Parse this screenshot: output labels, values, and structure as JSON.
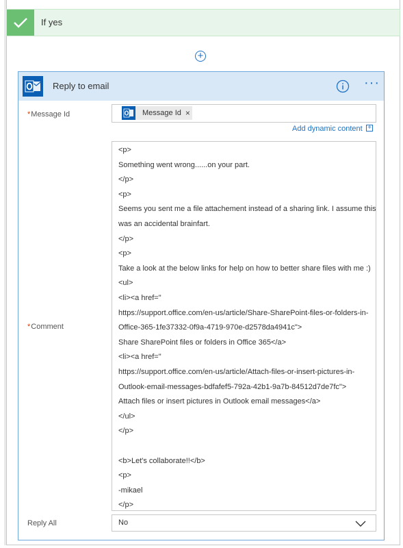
{
  "condition": {
    "label": "If yes"
  },
  "card": {
    "title": "Reply to email"
  },
  "fields": {
    "message_id": {
      "label": "Message Id",
      "required_marker": "*",
      "token_label": "Message Id",
      "token_remove": "×"
    },
    "add_dynamic_content": "Add dynamic content",
    "add_dynamic_plus": "+",
    "comment": {
      "label": "Comment",
      "required_marker": "*",
      "lines": [
        "<p>",
        "Something went wrong......on your part.",
        "</p>",
        "<p>",
        "Seems you sent me a file attachement instead of a sharing link. I assume this",
        "was an accidental brainfart.",
        "</p>",
        "<p>",
        "Take a look at the below links for help on how to better share files with me :)",
        "<ul>",
        "<li><a href=\"",
        "https://support.office.com/en-us/article/Share-SharePoint-files-or-folders-in-",
        "Office-365-1fe37332-0f9a-4719-970e-d2578da4941c\">",
        "Share SharePoint files or folders in Office 365</a>",
        "<li><a href=\"",
        "https://support.office.com/en-us/article/Attach-files-or-insert-pictures-in-",
        "Outlook-email-messages-bdfafef5-792a-42b1-9a7b-84512d7de7fc\">",
        "Attach files or insert pictures in Outlook email messages</a>",
        "</ul>",
        "</p>",
        "",
        "<b>Let's collaborate!!</b>",
        "<p>",
        "-mikael",
        "</p>"
      ]
    },
    "reply_all": {
      "label": "Reply All",
      "value": "No"
    }
  },
  "add_step_symbol": "+",
  "more_symbol": "···",
  "icons": {
    "check": "check-icon",
    "outlook": "outlook-icon",
    "info": "info-icon",
    "more": "more-icon",
    "chevron": "chevron-down-icon"
  },
  "colors": {
    "condition_bg": "#e8f5ea",
    "condition_accent": "#6bbf72",
    "card_header_bg": "#d9e8f6",
    "card_border": "#6ea8dc",
    "accent_blue": "#1f72c4",
    "outlook_blue": "#0a5fb4",
    "required_red": "#d83b01"
  }
}
